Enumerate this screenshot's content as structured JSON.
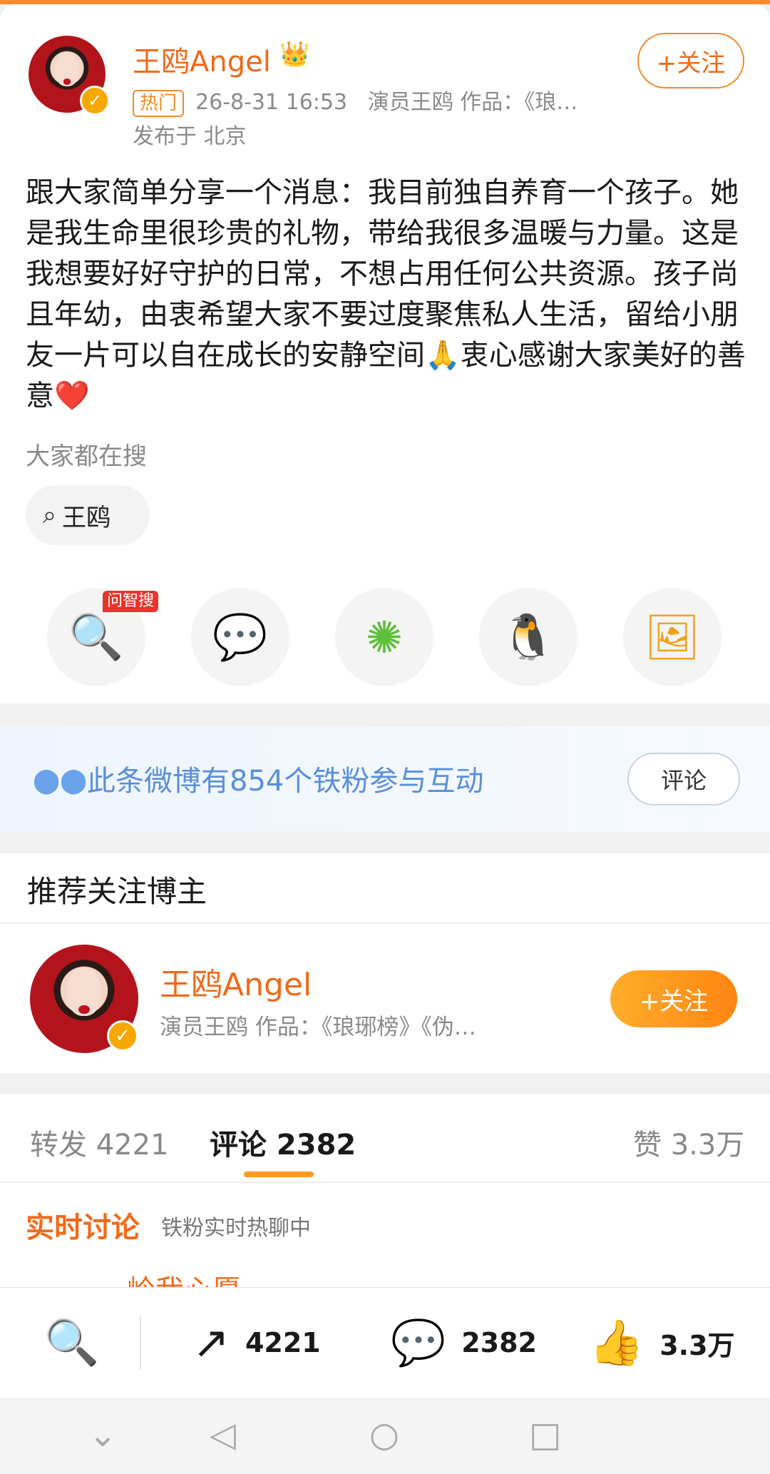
{
  "post": {
    "author_name": "王鸥Angel",
    "hot_tag": "热门",
    "timestamp": "26-8-31 16:53",
    "bio_preview": "演员王鸥 作品：《琅…",
    "location": "发布于 北京",
    "follow_label": "+关注",
    "content": "跟大家简单分享一个消息：我目前独自养育一个孩子。她是我生命里很珍贵的礼物，带给我很多温暖与力量。这是我想要好好守护的日常，不想占用任何公共资源。孩子尚且年幼，由衷希望大家不要过度聚焦私人生活，留给小朋友一片可以自在成长的安静空间🙏衷心感谢大家美好的善意❤️"
  },
  "search": {
    "section_label": "大家都在搜",
    "chip_label": "王鸥"
  },
  "share": {
    "badge": "问智搜"
  },
  "fans": {
    "text": "此条微博有854个铁粉参与互动",
    "button_label": "评论"
  },
  "recommend": {
    "title": "推荐关注博主",
    "name": "王鸥Angel",
    "bio": "演员王鸥 作品：《琅琊榜》《伪…",
    "follow_label": "+关注"
  },
  "tabs": {
    "repost": "转发 4221",
    "comment": "评论 2382",
    "like": "赞 3.3万"
  },
  "live": {
    "title": "实时讨论",
    "subtitle": "铁粉实时热聊中",
    "peek_name": "岭我心愿"
  },
  "bottom": {
    "repost_count": "4221",
    "comment_count": "2382",
    "like_count": "3.3万"
  },
  "colors": {
    "brand_orange": "#ef6a1a",
    "link_blue": "#5a8fd8",
    "verified": "#f6a800"
  }
}
